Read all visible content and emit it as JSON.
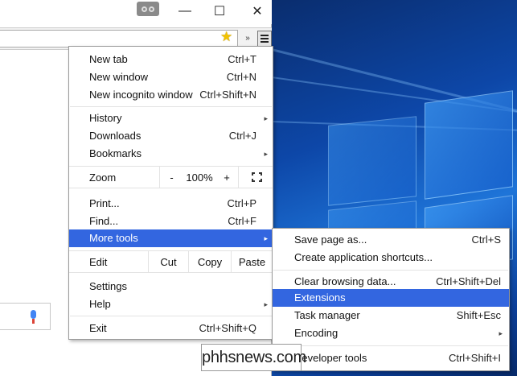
{
  "window": {
    "minimize_glyph": "—",
    "maximize_glyph": "☐",
    "close_glyph": "✕"
  },
  "toolbar": {
    "bookmark_icon": "star-icon",
    "extensions_overflow_glyph": "»"
  },
  "menu": {
    "new_tab": {
      "label": "New tab",
      "shortcut": "Ctrl+T"
    },
    "new_window": {
      "label": "New window",
      "shortcut": "Ctrl+N"
    },
    "new_incognito": {
      "label": "New incognito window",
      "shortcut": "Ctrl+Shift+N"
    },
    "history": {
      "label": "History"
    },
    "downloads": {
      "label": "Downloads",
      "shortcut": "Ctrl+J"
    },
    "bookmarks": {
      "label": "Bookmarks"
    },
    "zoom": {
      "label": "Zoom",
      "minus": "-",
      "level": "100%",
      "plus": "+"
    },
    "print": {
      "label": "Print...",
      "shortcut": "Ctrl+P"
    },
    "find": {
      "label": "Find...",
      "shortcut": "Ctrl+F"
    },
    "more_tools": {
      "label": "More tools"
    },
    "edit": {
      "label": "Edit",
      "cut": "Cut",
      "copy": "Copy",
      "paste": "Paste"
    },
    "settings": {
      "label": "Settings"
    },
    "help": {
      "label": "Help"
    },
    "exit": {
      "label": "Exit",
      "shortcut": "Ctrl+Shift+Q"
    },
    "submenu_arrow": "▸"
  },
  "submenu": {
    "save_page": {
      "label": "Save page as...",
      "shortcut": "Ctrl+S"
    },
    "app_shortcuts": {
      "label": "Create application shortcuts..."
    },
    "clear_data": {
      "label": "Clear browsing data...",
      "shortcut": "Ctrl+Shift+Del"
    },
    "extensions": {
      "label": "Extensions"
    },
    "task_manager": {
      "label": "Task manager",
      "shortcut": "Shift+Esc"
    },
    "encoding": {
      "label": "Encoding"
    },
    "dev_tools": {
      "label": "Developer tools",
      "shortcut": "Ctrl+Shift+I"
    }
  },
  "watermark": {
    "text": "phhsnews.com"
  },
  "colors": {
    "highlight": "#3366e0",
    "desktop": "#0d47a8"
  }
}
